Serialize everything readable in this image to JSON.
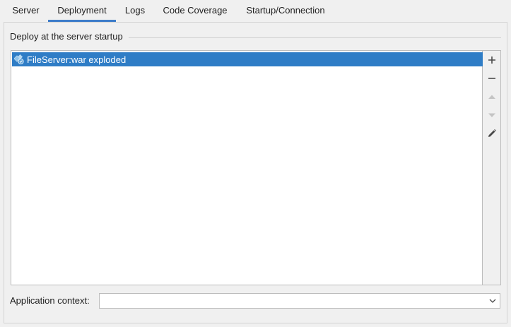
{
  "tabs": [
    {
      "label": "Server"
    },
    {
      "label": "Deployment",
      "active": true
    },
    {
      "label": "Logs"
    },
    {
      "label": "Code Coverage"
    },
    {
      "label": "Startup/Connection"
    }
  ],
  "deploy": {
    "group_title": "Deploy at the server startup",
    "items": [
      {
        "label": "FileServer:war exploded",
        "icon": "artifact-icon",
        "selected": true
      }
    ]
  },
  "toolbar": {
    "buttons": [
      "add-icon",
      "remove-icon",
      "move-up-icon",
      "move-down-icon",
      "edit-icon"
    ]
  },
  "context": {
    "label": "Application context:",
    "value": ""
  },
  "colors": {
    "selection": "#2f7dc6",
    "tab_underline": "#3d7cc9"
  }
}
